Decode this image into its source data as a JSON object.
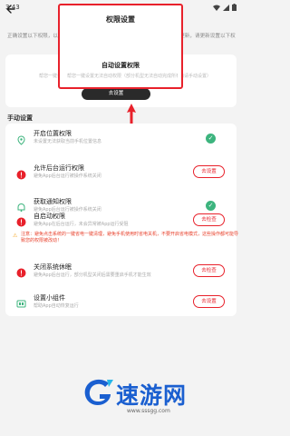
{
  "status_bar": {
    "time": "3:43"
  },
  "intro_text": "正确设置以下权限，以保障时刻守护在后台持续定位。如果您的定位无法持续更新，请更新设置以下权限",
  "auto_settings": {
    "title": "自动设置权限",
    "description": "帮您一键设置无法自动权限（部分机型无法自动完成所有权限，未完成的请手动设置）",
    "button_label": "去设置"
  },
  "dialog": {
    "title": "权限设置",
    "subtitle": "自动设置权限",
    "description": "帮您一键设置无法自动权限（部分机型无法自动完成所有权限，未完成的请手动设置）"
  },
  "manual_section": {
    "title": "手动设置"
  },
  "permissions": [
    {
      "title": "开启位置权限",
      "desc": "未设置无法获取当前手机位置信息",
      "status": "done"
    },
    {
      "title": "允许后台运行权限",
      "desc": "避免App后台运行被操作系统关闭",
      "status": "action",
      "button": "去设置"
    },
    {
      "title": "获取通知权限",
      "desc": "避免App后台运行被操作系统关闭",
      "status": "done"
    },
    {
      "title": "自启动权限",
      "desc": "避免App在后台运行，未会异常被App运行受阻",
      "status": "action",
      "button": "去检查",
      "warning": "注意：避免点击系统的一键省电一键清理，避免手机使用时省电关机，不要开启省电模式，这些操作都可能导致您的权限被改动！"
    },
    {
      "title": "关闭系统休眠",
      "desc": "避免App后台运行，部分机型关闭后需要重启手机才能生效",
      "status": "action",
      "button": "去检查"
    },
    {
      "title": "设置小组件",
      "desc": "帮助App自动恢复运行",
      "status": "action",
      "button": "去设置"
    }
  ],
  "watermark": {
    "brand": "速游网",
    "url": "www.sssgg.com"
  },
  "colors": {
    "accent": "#e8212b",
    "success": "#3db47e",
    "brand": "#1a5fd0"
  }
}
